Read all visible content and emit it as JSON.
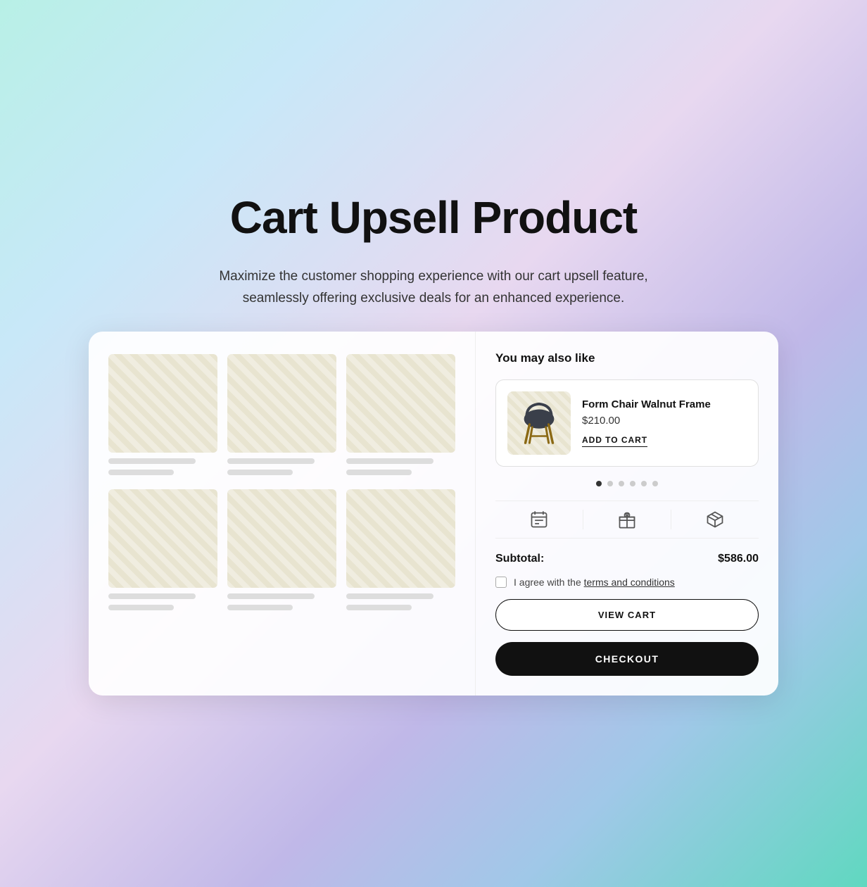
{
  "hero": {
    "title": "Cart Upsell Product",
    "subtitle": "Maximize the customer shopping experience with our cart upsell feature, seamlessly offering exclusive deals for an enhanced experience."
  },
  "upsell_section": {
    "title": "You may also like",
    "product": {
      "name": "Form Chair Walnut Frame",
      "price": "$210.00",
      "add_to_cart_label": "ADD TO CART"
    },
    "dots_count": 6,
    "active_dot": 0
  },
  "cart": {
    "subtotal_label": "Subtotal:",
    "subtotal_value": "$586.00",
    "terms_text": "I agree with the ",
    "terms_link": "terms and conditions",
    "view_cart_label": "VIEW CART",
    "checkout_label": "CHECKOUT"
  }
}
